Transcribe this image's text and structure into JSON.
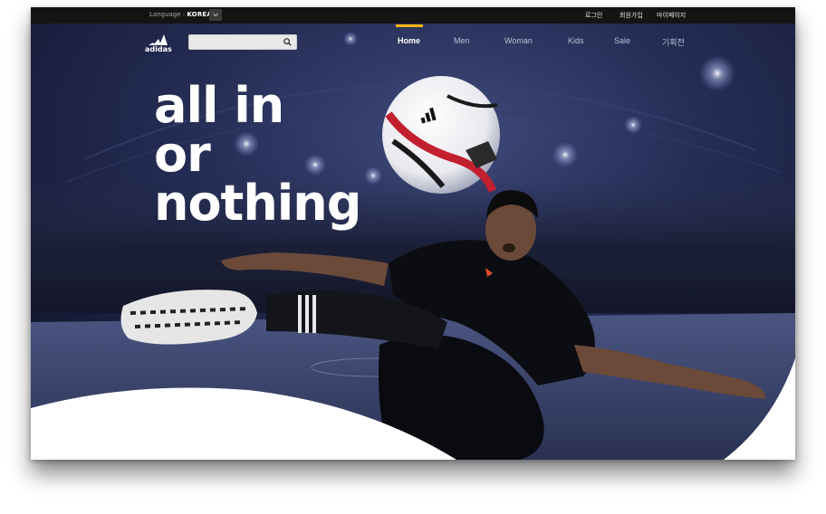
{
  "topbar": {
    "language_label": "Language :",
    "language_value": "KOREAN",
    "links": [
      "로그인",
      "회원가입",
      "마이페이지"
    ]
  },
  "nav": {
    "brand": "adidas",
    "search_placeholder": "",
    "items": [
      "Home",
      "Men",
      "Woman",
      "Kids",
      "Sale",
      "기획전"
    ],
    "active_item": "Home"
  },
  "hero": {
    "headline_lines": [
      "all in",
      "or",
      "nothing"
    ]
  },
  "colors": {
    "accent": "#f2b705",
    "topbar": "#141414",
    "hero_bg": "#1a2040"
  },
  "icons": {
    "search": "search-icon",
    "dropdown": "chevron-down-icon",
    "logo": "adidas-logo"
  }
}
